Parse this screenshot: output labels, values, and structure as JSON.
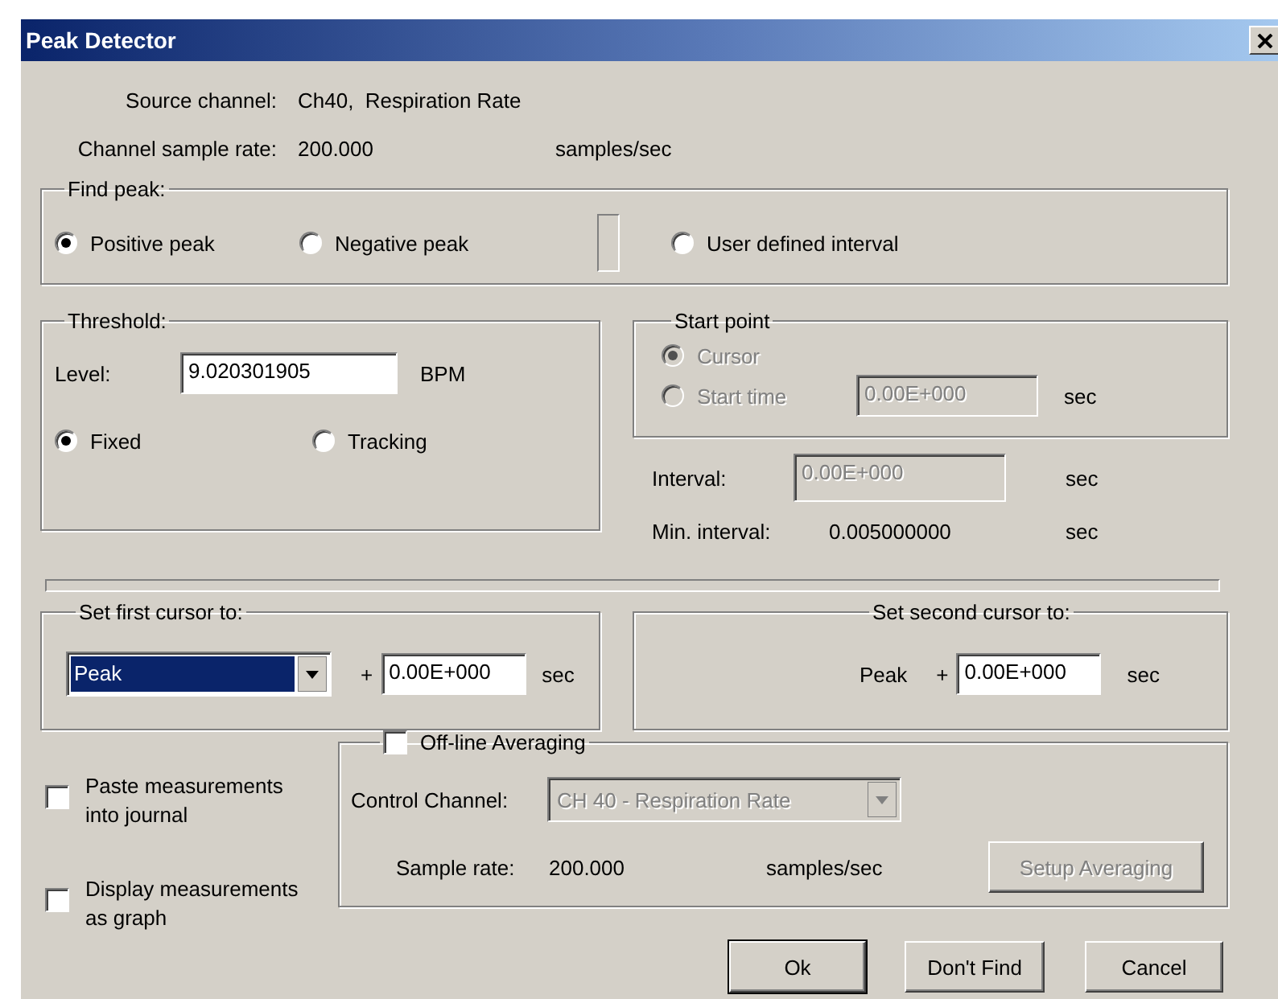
{
  "window": {
    "title": "Peak Detector"
  },
  "source_channel": {
    "label": "Source channel:",
    "value": "Ch40,  Respiration Rate"
  },
  "sample_rate": {
    "label": "Channel sample rate:",
    "value": "200.000",
    "unit": "samples/sec"
  },
  "find_peak": {
    "title": "Find peak:",
    "options": [
      {
        "label": "Positive peak",
        "selected": true
      },
      {
        "label": "Negative peak",
        "selected": false
      },
      {
        "label": "User defined interval",
        "selected": false
      }
    ]
  },
  "threshold": {
    "title": "Threshold:",
    "level_label": "Level:",
    "level_value": "9.020301905",
    "unit": "BPM",
    "modes": [
      {
        "label": "Fixed",
        "selected": true
      },
      {
        "label": "Tracking",
        "selected": false
      }
    ]
  },
  "start_point": {
    "title": "Start point",
    "disabled": true,
    "options": [
      {
        "label": "Cursor",
        "selected": true
      },
      {
        "label": "Start time",
        "selected": false
      }
    ],
    "start_time_value": "0.00E+000",
    "unit": "sec"
  },
  "interval": {
    "label": "Interval:",
    "value": "0.00E+000",
    "disabled": true,
    "unit": "sec"
  },
  "min_interval": {
    "label": "Min. interval:",
    "value": "0.005000000",
    "unit": "sec"
  },
  "first_cursor": {
    "title": "Set first cursor to:",
    "selection": "Peak",
    "plus": "+",
    "offset": "0.00E+000",
    "unit": "sec"
  },
  "second_cursor": {
    "title": "Set second cursor to:",
    "anchor": "Peak",
    "plus": "+",
    "offset": "0.00E+000",
    "unit": "sec"
  },
  "checkboxes": [
    {
      "label": "Paste measurements into journal",
      "checked": false
    },
    {
      "label": "Display measurements as graph",
      "checked": false
    }
  ],
  "offline_averaging": {
    "label": "Off-line Averaging",
    "checked": false,
    "disabled": true,
    "control_channel_label": "Control Channel:",
    "control_channel": "CH 40 - Respiration Rate",
    "sample_rate_label": "Sample rate:",
    "sample_rate": "200.000",
    "unit": "samples/sec",
    "setup_button": "Setup Averaging"
  },
  "buttons": [
    {
      "label": "Ok",
      "default": true
    },
    {
      "label": "Don't Find",
      "default": false
    },
    {
      "label": "Cancel",
      "default": false
    }
  ]
}
